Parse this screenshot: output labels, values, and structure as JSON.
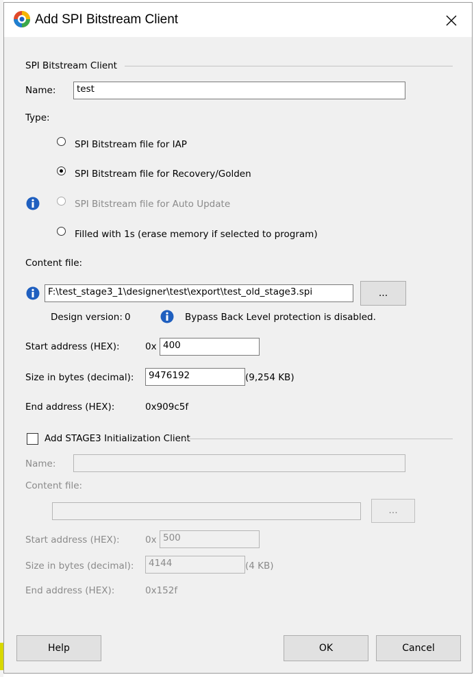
{
  "window": {
    "title": "Add SPI Bitstream Client"
  },
  "group1": {
    "title": "SPI Bitstream Client"
  },
  "name": {
    "label": "Name:",
    "value": "test"
  },
  "type": {
    "label": "Type:",
    "options": [
      {
        "label": "SPI Bitstream file for IAP",
        "selected": false,
        "enabled": true
      },
      {
        "label": "SPI Bitstream file for Recovery/Golden",
        "selected": true,
        "enabled": true
      },
      {
        "label": "SPI Bitstream file for Auto Update",
        "selected": false,
        "enabled": false
      },
      {
        "label": "Filled with 1s (erase memory if selected to program)",
        "selected": false,
        "enabled": true
      }
    ]
  },
  "content": {
    "label": "Content file:",
    "path": "F:\\test_stage3_1\\designer\\test\\export\\test_old_stage3.spi",
    "browse": "...",
    "design_version_label": "Design version:",
    "design_version": "0",
    "bypass_message": "Bypass Back Level protection is disabled."
  },
  "start_address": {
    "label": "Start address (HEX):",
    "prefix": "0x",
    "value": "400"
  },
  "size": {
    "label": "Size in bytes (decimal):",
    "value": "9476192",
    "kb": "(9,254 KB)"
  },
  "end_address": {
    "label": "End address (HEX):",
    "value": "0x909c5f"
  },
  "stage3": {
    "checkbox_label": "Add STAGE3 Initialization Client",
    "checked": false,
    "name_label": "Name:",
    "name_value": "",
    "content_label": "Content file:",
    "content_value": "",
    "browse": "...",
    "start_label": "Start address (HEX):",
    "start_prefix": "0x",
    "start_value": "500",
    "size_label": "Size in bytes (decimal):",
    "size_value": "4144",
    "size_kb": "(4 KB)",
    "end_label": "End address (HEX):",
    "end_value": "0x152f"
  },
  "buttons": {
    "help": "Help",
    "ok": "OK",
    "cancel": "Cancel"
  },
  "colors": {
    "info_blue": "#1f5fbf",
    "disabled_text": "#8a8a8a",
    "dialog_bg": "#f0f0f0"
  }
}
